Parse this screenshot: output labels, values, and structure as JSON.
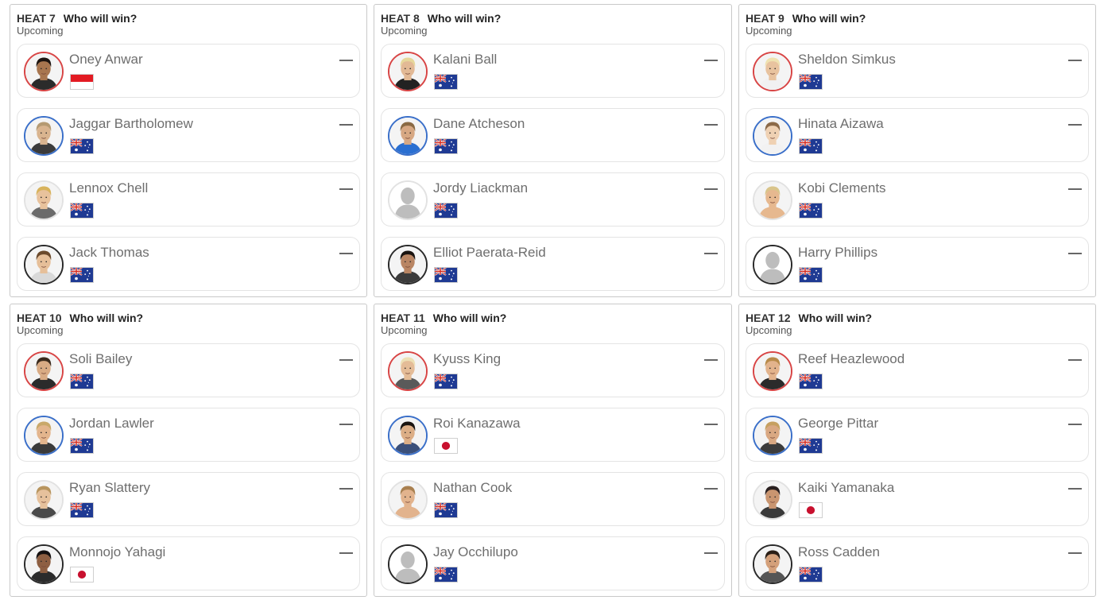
{
  "heats": [
    {
      "title": "HEAT 7",
      "question": "Who will win?",
      "status": "Upcoming",
      "surfers": [
        {
          "name": "Oney Anwar",
          "flag": "indonesia-flag",
          "ring": "red",
          "skin": "#a8764f",
          "hair": "#1c1410",
          "shirt": "#2b2b2b"
        },
        {
          "name": "Jaggar Bartholomew",
          "flag": "australia-flag",
          "ring": "blue",
          "skin": "#d9b48f",
          "hair": "#b59a72",
          "shirt": "#3b3b3b"
        },
        {
          "name": "Lennox Chell",
          "flag": "australia-flag",
          "ring": "white",
          "skin": "#e8c29c",
          "hair": "#d8b35c",
          "shirt": "#6b6b6b"
        },
        {
          "name": "Jack Thomas",
          "flag": "australia-flag",
          "ring": "black",
          "skin": "#e6bf99",
          "hair": "#6b4a2c",
          "shirt": "#d9d9d9"
        }
      ]
    },
    {
      "title": "HEAT 8",
      "question": "Who will win?",
      "status": "Upcoming",
      "surfers": [
        {
          "name": "Kalani Ball",
          "flag": "australia-flag",
          "ring": "red",
          "skin": "#e2b995",
          "hair": "#e6d79a",
          "shirt": "#222222"
        },
        {
          "name": "Dane Atcheson",
          "flag": "australia-flag",
          "ring": "blue",
          "skin": "#d7a883",
          "hair": "#8a6a44",
          "shirt": "#2a6fd1"
        },
        {
          "name": "Jordy Liackman",
          "flag": "australia-flag",
          "ring": "white",
          "skin": "",
          "hair": "",
          "shirt": "",
          "placeholder": true
        },
        {
          "name": "Elliot Paerata-Reid",
          "flag": "australia-flag",
          "ring": "black",
          "skin": "#b98563",
          "hair": "#1a1410",
          "shirt": "#3b3b3b"
        }
      ]
    },
    {
      "title": "HEAT 9",
      "question": "Who will win?",
      "status": "Upcoming",
      "surfers": [
        {
          "name": "Sheldon Simkus",
          "flag": "australia-flag",
          "ring": "red",
          "skin": "#e8c39f",
          "hair": "#efe2b0",
          "shirt": "#f1f1f1"
        },
        {
          "name": "Hinata Aizawa",
          "flag": "australia-flag",
          "ring": "blue",
          "skin": "#efd1b3",
          "hair": "#8c6a48",
          "shirt": "#f2f2f2"
        },
        {
          "name": "Kobi Clements",
          "flag": "australia-flag",
          "ring": "white",
          "skin": "#e6b88f",
          "hair": "#d9c48a",
          "shirt": "#e6b88f"
        },
        {
          "name": "Harry Phillips",
          "flag": "australia-flag",
          "ring": "black",
          "skin": "",
          "hair": "",
          "shirt": "",
          "placeholder": true
        }
      ]
    },
    {
      "title": "HEAT 10",
      "question": "Who will win?",
      "status": "Upcoming",
      "surfers": [
        {
          "name": "Soli Bailey",
          "flag": "australia-flag",
          "ring": "red",
          "skin": "#d9ab84",
          "hair": "#3a2a1c",
          "shirt": "#2b2b2b"
        },
        {
          "name": "Jordan Lawler",
          "flag": "australia-flag",
          "ring": "blue",
          "skin": "#e3b58d",
          "hair": "#c9a86a",
          "shirt": "#3a3a3a"
        },
        {
          "name": "Ryan Slattery",
          "flag": "australia-flag",
          "ring": "white",
          "skin": "#e6c19c",
          "hair": "#b8955e",
          "shirt": "#4a4a4a"
        },
        {
          "name": "Monnojo Yahagi",
          "flag": "japan-flag",
          "ring": "black",
          "skin": "#8e5f42",
          "hair": "#141010",
          "shirt": "#2b2b2b"
        }
      ]
    },
    {
      "title": "HEAT 11",
      "question": "Who will win?",
      "status": "Upcoming",
      "surfers": [
        {
          "name": "Kyuss King",
          "flag": "australia-flag",
          "ring": "red",
          "skin": "#e4bc97",
          "hair": "#ede0b5",
          "shirt": "#5a5a5a"
        },
        {
          "name": "Roi Kanazawa",
          "flag": "japan-flag",
          "ring": "blue",
          "skin": "#dcae86",
          "hair": "#1a1410",
          "shirt": "#3a4f7a"
        },
        {
          "name": "Nathan Cook",
          "flag": "australia-flag",
          "ring": "white",
          "skin": "#e2b38d",
          "hair": "#a98050",
          "shirt": "#e2b38d"
        },
        {
          "name": "Jay Occhilupo",
          "flag": "australia-flag",
          "ring": "black",
          "skin": "",
          "hair": "",
          "shirt": "",
          "placeholder": true
        }
      ]
    },
    {
      "title": "HEAT 12",
      "question": "Who will win?",
      "status": "Upcoming",
      "surfers": [
        {
          "name": "Reef Heazlewood",
          "flag": "australia-flag",
          "ring": "red",
          "skin": "#e2b38c",
          "hair": "#b88b4a",
          "shirt": "#2b2b2b"
        },
        {
          "name": "George Pittar",
          "flag": "australia-flag",
          "ring": "blue",
          "skin": "#d9a882",
          "hair": "#c6a060",
          "shirt": "#3c3c3c"
        },
        {
          "name": "Kaiki Yamanaka",
          "flag": "japan-flag",
          "ring": "white",
          "skin": "#c99570",
          "hair": "#2a2020",
          "shirt": "#3a3a3a"
        },
        {
          "name": "Ross Cadden",
          "flag": "australia-flag",
          "ring": "black",
          "skin": "#d4a07a",
          "hair": "#2a1e16",
          "shirt": "#555555"
        }
      ]
    }
  ],
  "colors": {
    "ring_red": "#d84545",
    "ring_blue": "#3a6fc9",
    "ring_white": "#e2e2e2",
    "ring_black": "#2a2a2a"
  },
  "icons": {
    "status_indicator": "em-dash-icon",
    "placeholder_avatar": "person-silhouette-icon"
  }
}
